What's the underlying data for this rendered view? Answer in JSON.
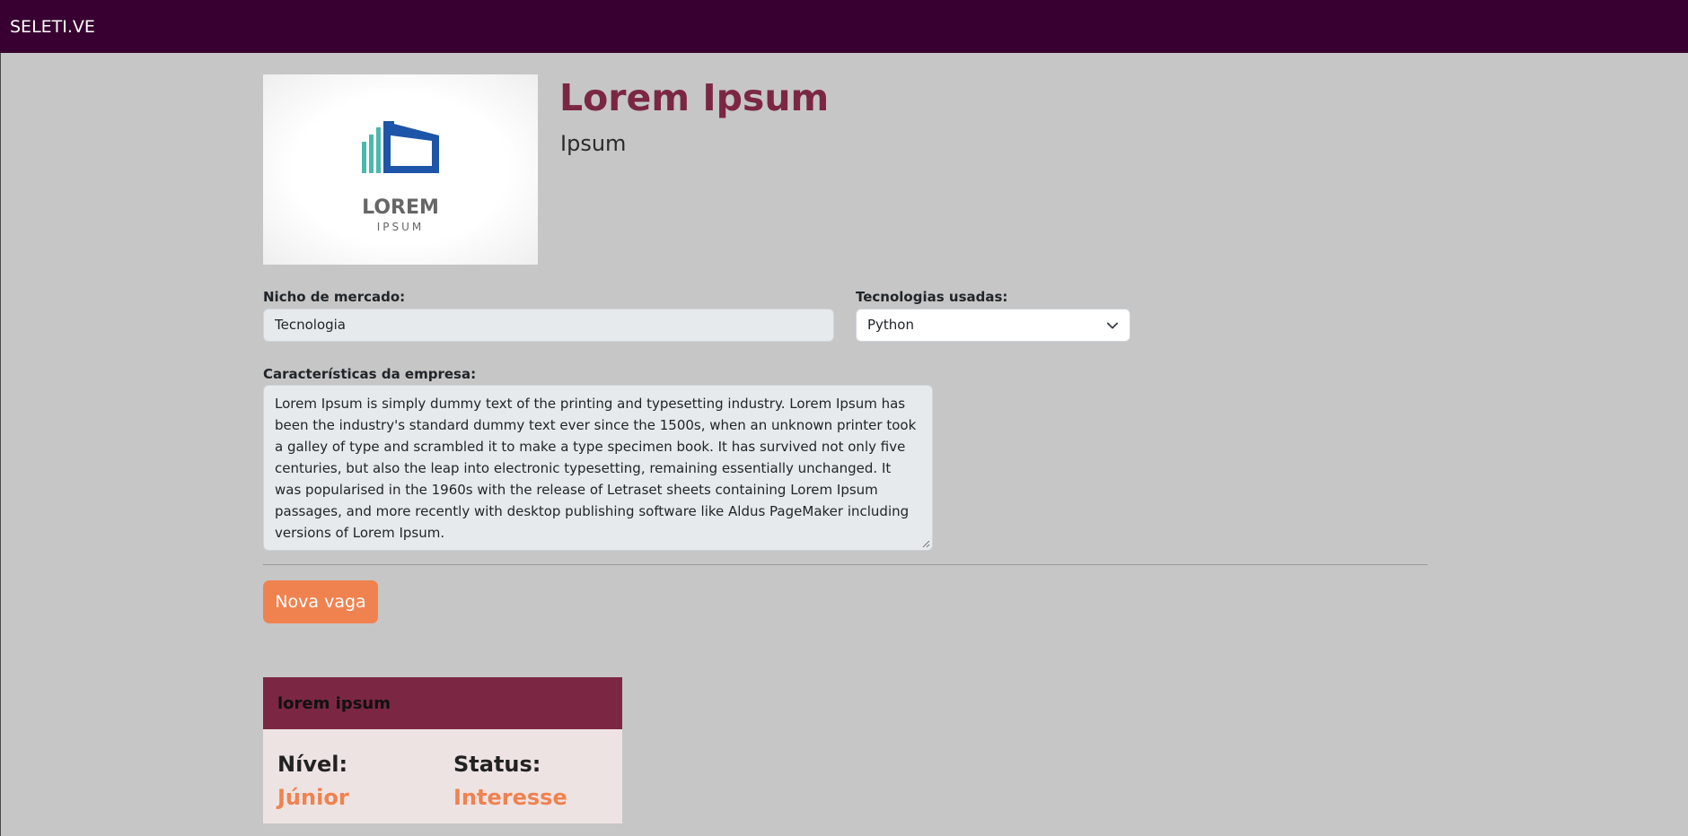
{
  "navbar": {
    "brand": "SELETI.VE"
  },
  "company": {
    "logo_text_main": "LOREM",
    "logo_text_sub": "IPSUM",
    "name": "Lorem Ipsum",
    "subtitle": "Ipsum"
  },
  "form": {
    "nicho_label": "Nicho de mercado:",
    "nicho_value": "Tecnologia",
    "tech_label": "Tecnologias usadas:",
    "tech_selected": "Python",
    "caracteristicas_label": "Características da empresa:",
    "caracteristicas_value": "Lorem Ipsum is simply dummy text of the printing and typesetting industry. Lorem Ipsum has been the industry's standard dummy text ever since the 1500s, when an unknown printer took a galley of type and scrambled it to make a type specimen book. It has survived not only five centuries, but also the leap into electronic typesetting, remaining essentially unchanged. It was popularised in the 1960s with the release of Letraset sheets containing Lorem Ipsum passages, and more recently with desktop publishing software like Aldus PageMaker including versions of Lorem Ipsum."
  },
  "actions": {
    "nova_vaga_label": "Nova vaga"
  },
  "vaga_card": {
    "title": "lorem ipsum",
    "nivel_label": "Nível:",
    "nivel_value": "Júnior",
    "status_label": "Status:",
    "status_value": "Interesse"
  },
  "colors": {
    "navbar_bg": "#380030",
    "page_bg": "#c6c6c6",
    "accent_wine": "#7b2743",
    "accent_orange": "#f0824f",
    "logo_teal": "#4bb8ae",
    "logo_blue": "#1d55a8",
    "logo_gray": "#666666"
  },
  "icons": {
    "select_chevron": "chevron-down-icon",
    "textarea_resize": "resize-grip-icon"
  }
}
